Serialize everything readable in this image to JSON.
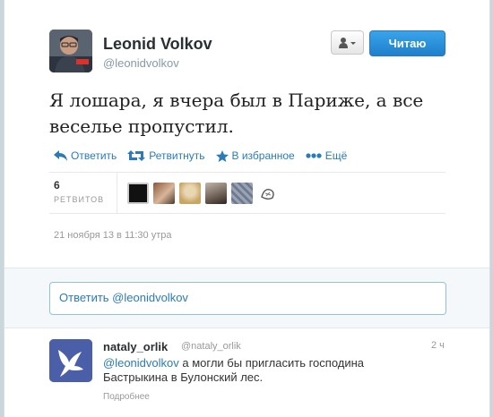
{
  "author": {
    "name": "Leonid Volkov",
    "handle": "@leonidvolkov"
  },
  "header": {
    "follow_label": "Читаю"
  },
  "tweet": {
    "line1": "Я лошара, я вчера был в Париже, а все",
    "line2": "веселье пропустил."
  },
  "actions": {
    "reply": "Ответить",
    "retweet": "Ретвитнуть",
    "favorite": "В избранное",
    "more": "Ещё"
  },
  "stats": {
    "retweet_count": "6",
    "retweet_label": "РЕТВИТОВ",
    "retweeter_avatars": 6
  },
  "timestamp": "21 ноября 13 в 11:30 утра",
  "reply_box": {
    "text": "Ответить @leonidvolkov"
  },
  "replies": [
    {
      "name": "nataly_orlik",
      "handle": "@nataly_orlik",
      "time": "2 ч",
      "mention": "@leonidvolkov",
      "text_line1": " а могли бы пригласить господина",
      "text_line2": "Бастрыкина в Булонский лес.",
      "more": "Подробнее"
    }
  ],
  "colors": {
    "link": "#2b7bb9",
    "follow_button": "#2b8ad9",
    "background": "#c9d6dc"
  }
}
